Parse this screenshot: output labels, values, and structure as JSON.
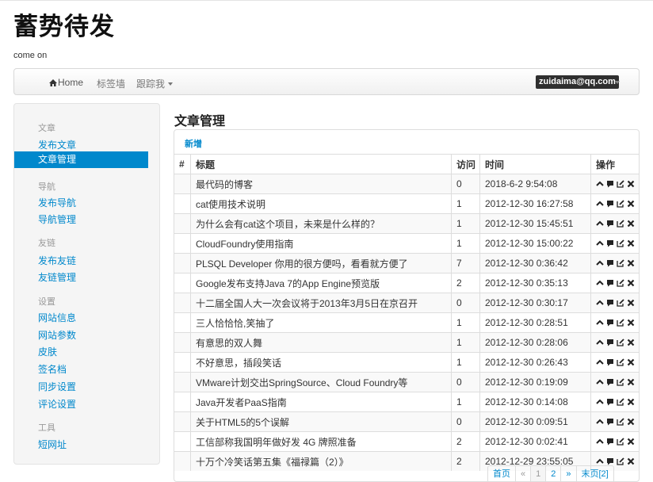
{
  "site": {
    "title": "蓄势待发",
    "subtitle": "come on"
  },
  "nav": {
    "home": "Home",
    "tag_wall": "标签墙",
    "follow": "跟踪我",
    "user": "zuidaima@qq.com"
  },
  "sidebar": {
    "sections": [
      {
        "heading": "文章",
        "items": [
          "发布文章",
          "文章管理"
        ]
      },
      {
        "heading": "导航",
        "items": [
          "发布导航",
          "导航管理"
        ]
      },
      {
        "heading": "友链",
        "items": [
          "发布友链",
          "友链管理"
        ]
      },
      {
        "heading": "设置",
        "items": [
          "网站信息",
          "网站参数",
          "皮肤",
          "签名档",
          "同步设置",
          "评论设置"
        ]
      },
      {
        "heading": "工具",
        "items": [
          "短网址"
        ]
      }
    ],
    "active": "文章管理"
  },
  "main": {
    "title": "文章管理",
    "new_label": "新增",
    "columns": [
      "#",
      "标题",
      "访问",
      "时间",
      "操作"
    ],
    "rows": [
      {
        "title": "最代码的博客",
        "visits": "0",
        "time": "2018-6-2 9:54:08"
      },
      {
        "title": "cat使用技术说明",
        "visits": "1",
        "time": "2012-12-30 16:27:58"
      },
      {
        "title": "为什么会有cat这个项目，未来是什么样的？",
        "visits": "1",
        "time": "2012-12-30 15:45:51"
      },
      {
        "title": "CloudFoundry使用指南",
        "visits": "1",
        "time": "2012-12-30 15:00:22"
      },
      {
        "title": "PLSQL Developer 你用的很方便吗，看看就方便了",
        "visits": "7",
        "time": "2012-12-30 0:36:42"
      },
      {
        "title": "Google发布支持Java 7的App Engine预览版",
        "visits": "2",
        "time": "2012-12-30 0:35:13"
      },
      {
        "title": "十二届全国人大一次会议将于2013年3月5日在京召开",
        "visits": "0",
        "time": "2012-12-30 0:30:17"
      },
      {
        "title": "三人恰恰恰,笑抽了",
        "visits": "1",
        "time": "2012-12-30 0:28:51"
      },
      {
        "title": "有意思的双人舞",
        "visits": "1",
        "time": "2012-12-30 0:28:06"
      },
      {
        "title": "不好意思，插段笑话",
        "visits": "1",
        "time": "2012-12-30 0:26:43"
      },
      {
        "title": "VMware计划交出SpringSource、Cloud Foundry等",
        "visits": "0",
        "time": "2012-12-30 0:19:09"
      },
      {
        "title": "Java开发者PaaS指南",
        "visits": "1",
        "time": "2012-12-30 0:14:08"
      },
      {
        "title": "关于HTML5的5个误解",
        "visits": "0",
        "time": "2012-12-30 0:09:51"
      },
      {
        "title": "工信部称我国明年做好发 4G 牌照准备",
        "visits": "2",
        "time": "2012-12-30 0:02:41"
      },
      {
        "title": "十万个冷笑话第五集《福禄篇（2）》",
        "visits": "2",
        "time": "2012-12-29 23:55:05"
      }
    ],
    "row_icons": [
      "up-icon",
      "comment-icon",
      "edit-icon",
      "delete-icon"
    ]
  },
  "pager": {
    "first": "首页",
    "prev": "«",
    "pages": [
      "1",
      "2"
    ],
    "next": "»",
    "last": "末页[2]"
  },
  "colors": {
    "link": "#0088cc",
    "active_bg": "#0088cc",
    "badge_bg": "#2f2f2f"
  }
}
